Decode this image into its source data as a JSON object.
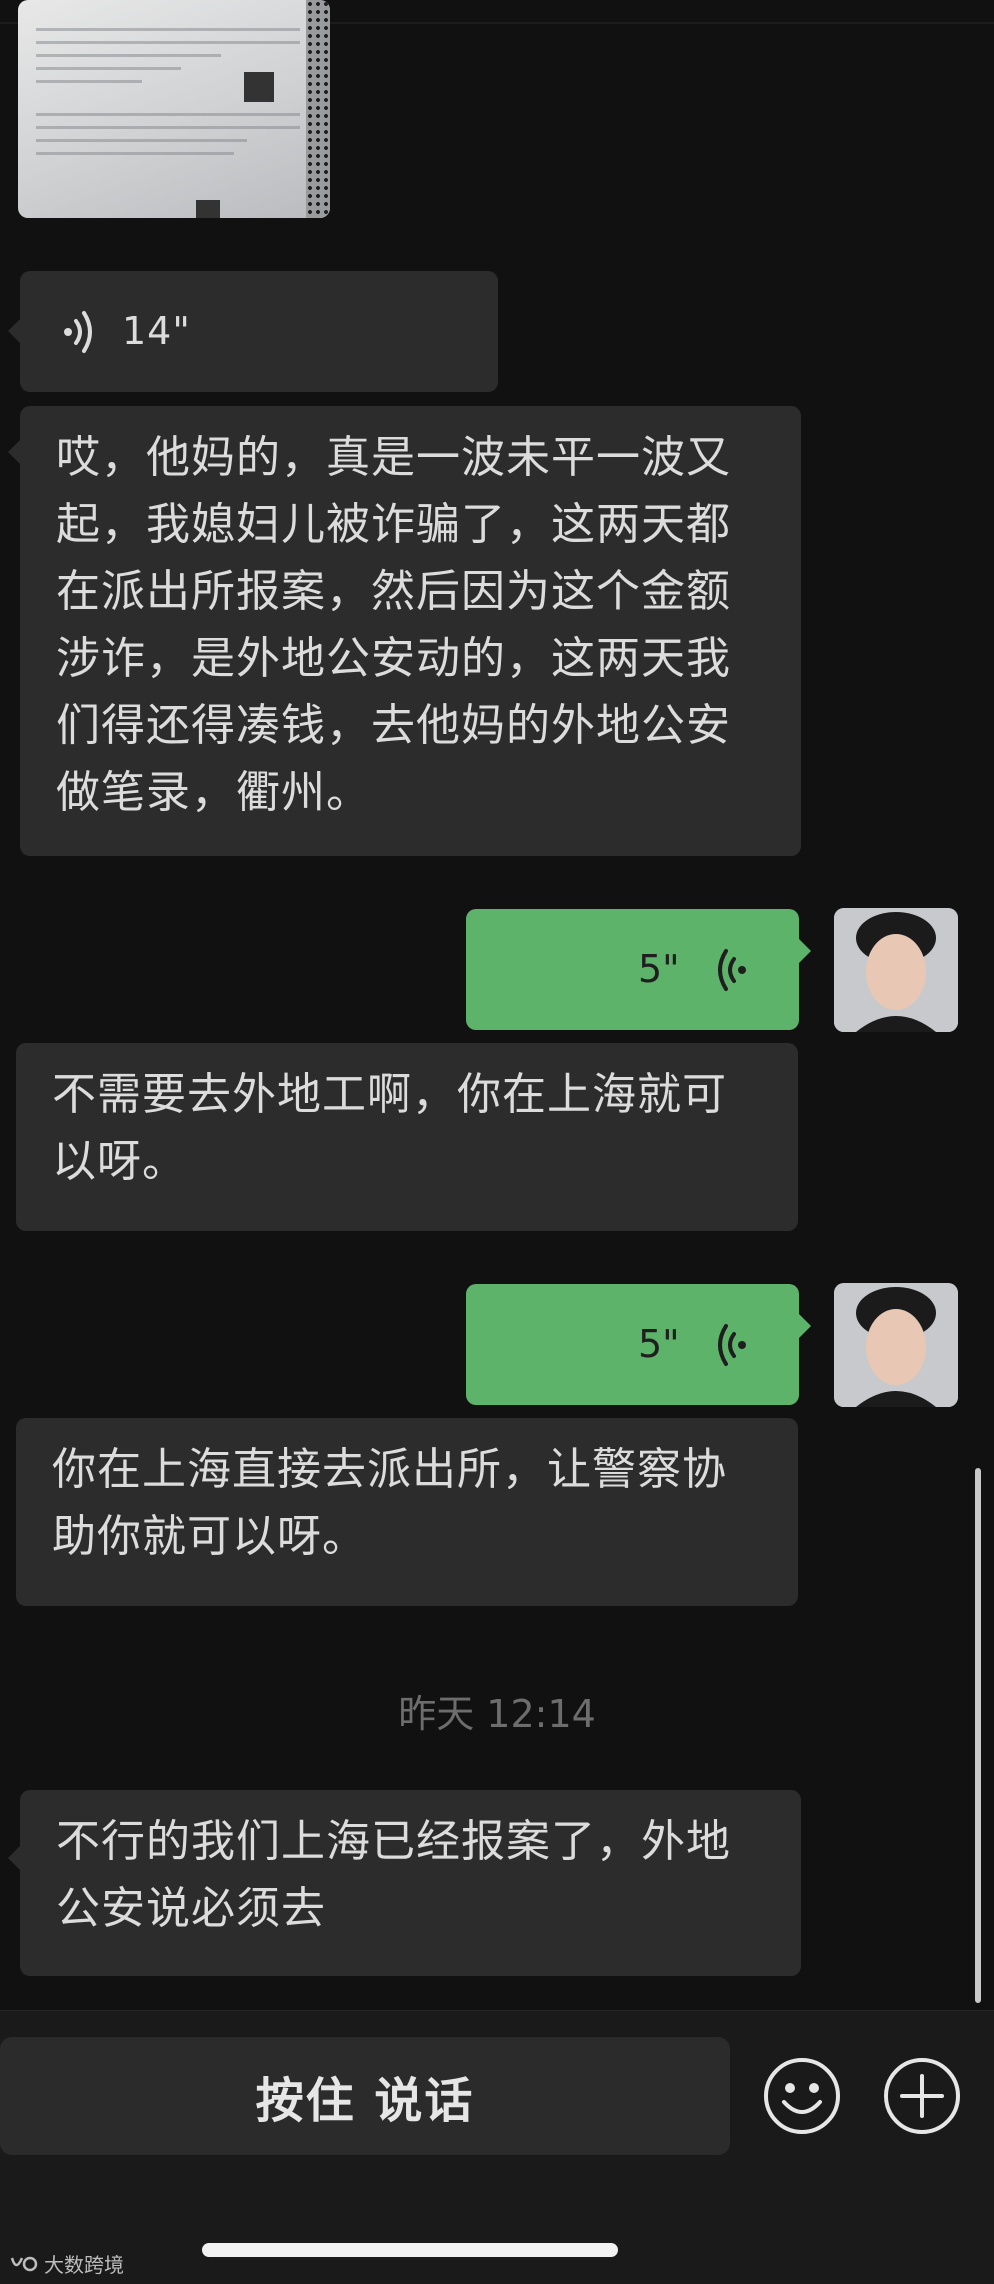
{
  "chat": {
    "voice_in": {
      "duration": "14\""
    },
    "messages": [
      {
        "text": "哎，他妈的，真是一波未平一波又起，我媳妇儿被诈骗了，这两天都在派出所报案，然后因为这个金额涉诈，是外地公安动的，这两天我们得还得凑钱，去他妈的外地公安做笔录，衢州。"
      },
      {
        "text": "不需要去外地工啊，你在上海就可以呀。"
      },
      {
        "text": "你在上海直接去派出所，让警察协助你就可以呀。"
      },
      {
        "text": "不行的我们上海已经报案了，外地公安说必须去"
      }
    ],
    "voice_out": [
      {
        "duration": "5\""
      },
      {
        "duration": "5\""
      }
    ],
    "timestamp": "昨天 12:14"
  },
  "input_bar": {
    "talk_label": "按住 说话"
  },
  "watermark": {
    "text": "大数跨境"
  },
  "colors": {
    "background": "#111111",
    "incoming_bubble": "#2c2c2c",
    "outgoing_bubble": "#5db36a"
  },
  "icons": [
    "voice-wave-icon",
    "emoji-icon",
    "plus-icon"
  ]
}
